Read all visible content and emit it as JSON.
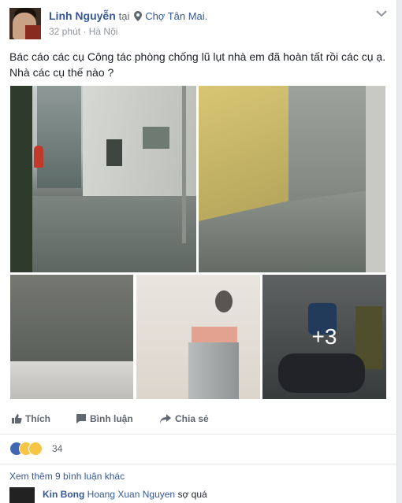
{
  "header": {
    "author": "Linh Nguyễn",
    "at": "tại",
    "place": "Chợ Tân Mai.",
    "time": "32 phút",
    "separator": "·",
    "location": "Hà Nội"
  },
  "post_text": "Bác cáo các cụ Công tác phòng chống lũ lụt nhà em đã hoàn tất rồi các cụ ạ. Nhà các cụ thế nào ?",
  "photos": {
    "more_label": "+3"
  },
  "actions": {
    "like": "Thích",
    "comment": "Bình luận",
    "share": "Chia sẻ"
  },
  "reactions": {
    "count": "34",
    "types": [
      "like-icon",
      "laugh-icon",
      "wow-icon"
    ]
  },
  "comments": {
    "view_more": "Xem thêm 9 bình luận khác",
    "items": [
      {
        "author": "Kin Bong",
        "tag": "Hoang Xuan Nguyen",
        "body": "sợ quá"
      }
    ]
  },
  "colors": {
    "link": "#365899",
    "text": "#1d2129",
    "muted": "#90949c",
    "like": "#4267b2"
  }
}
